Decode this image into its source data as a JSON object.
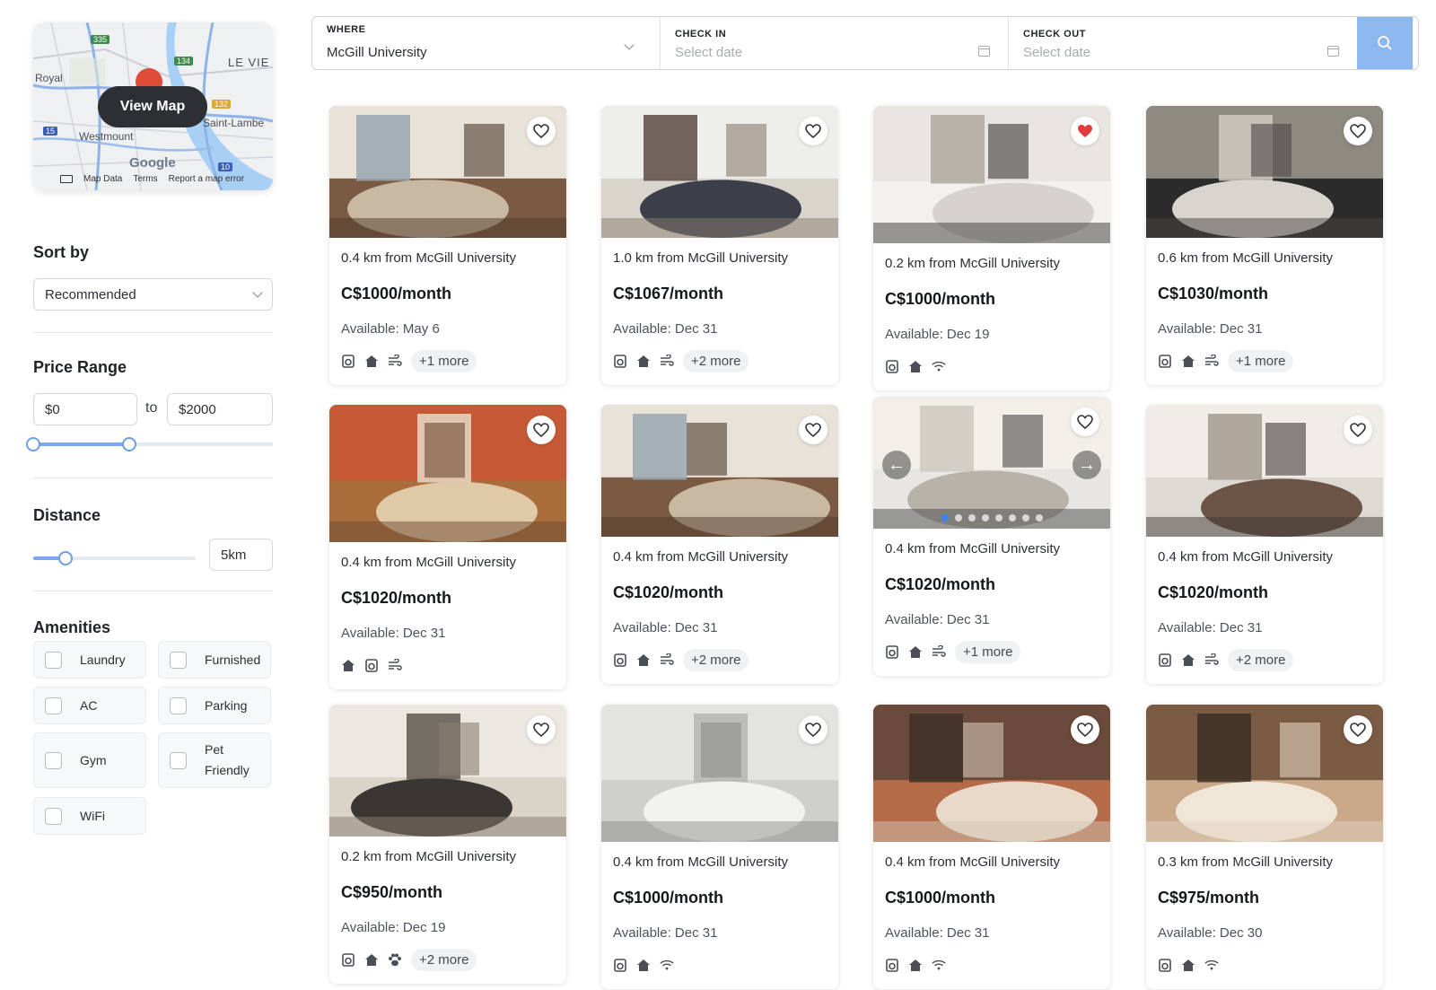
{
  "map": {
    "view_map_label": "View Map",
    "place_labels": [
      "Royal",
      "LE VIE",
      "Westmount",
      "Saint-Lambe"
    ],
    "route_badges": [
      "335",
      "134",
      "132",
      "15",
      "10"
    ],
    "google_label": "Google",
    "footer": {
      "map_data": "Map Data",
      "terms": "Terms",
      "report": "Report a map error"
    }
  },
  "filters": {
    "sort_title": "Sort by",
    "sort_value": "Recommended",
    "price_title": "Price Range",
    "price_min": "$0",
    "price_to": "to",
    "price_max": "$2000",
    "price_range_fraction": [
      0.0,
      0.4
    ],
    "distance_title": "Distance",
    "distance_value": "5km",
    "distance_fraction": 0.2,
    "amenities_title": "Amenities",
    "amenities": [
      "Laundry",
      "Furnished",
      "AC",
      "Parking",
      "Gym",
      "Pet Friendly",
      "WiFi"
    ]
  },
  "search": {
    "where_label": "WHERE",
    "where_value": "McGill University",
    "checkin_label": "CHECK IN",
    "checkin_placeholder": "Select date",
    "checkout_label": "CHECK OUT",
    "checkout_placeholder": "Select date"
  },
  "listings": [
    {
      "distance": "0.4 km from McGill University",
      "price": "C$1000/month",
      "available": "Available: May 6",
      "icons": [
        "laundry-icon",
        "home-icon",
        "ac-icon"
      ],
      "more": "+1 more",
      "favorited": false
    },
    {
      "distance": "1.0 km from McGill University",
      "price": "C$1067/month",
      "available": "Available: Dec 31",
      "icons": [
        "laundry-icon",
        "home-icon",
        "ac-icon"
      ],
      "more": "+2 more",
      "favorited": false
    },
    {
      "distance": "0.2 km from McGill University",
      "price": "C$1000/month",
      "available": "Available: Dec 19",
      "icons": [
        "laundry-icon",
        "home-icon",
        "wifi-icon"
      ],
      "more": "",
      "favorited": true
    },
    {
      "distance": "0.6 km from McGill University",
      "price": "C$1030/month",
      "available": "Available: Dec 31",
      "icons": [
        "laundry-icon",
        "home-icon",
        "ac-icon"
      ],
      "more": "+1 more",
      "favorited": false
    },
    {
      "distance": "0.4 km from McGill University",
      "price": "C$1020/month",
      "available": "Available: Dec 31",
      "icons": [
        "home-icon",
        "laundry-icon",
        "ac-icon"
      ],
      "more": "",
      "favorited": false
    },
    {
      "distance": "0.4 km from McGill University",
      "price": "C$1020/month",
      "available": "Available: Dec 31",
      "icons": [
        "laundry-icon",
        "home-icon",
        "ac-icon"
      ],
      "more": "+2 more",
      "favorited": false
    },
    {
      "distance": "0.4 km from McGill University",
      "price": "C$1020/month",
      "available": "Available: Dec 31",
      "icons": [
        "laundry-icon",
        "home-icon",
        "ac-icon"
      ],
      "more": "+1 more",
      "favorited": false,
      "carousel": {
        "count": 8,
        "active": 0,
        "prev_icon": "arrow-left-icon",
        "next_icon": "arrow-right-icon"
      }
    },
    {
      "distance": "0.4 km from McGill University",
      "price": "C$1020/month",
      "available": "Available: Dec 31",
      "icons": [
        "laundry-icon",
        "home-icon",
        "ac-icon"
      ],
      "more": "+2 more",
      "favorited": false
    },
    {
      "distance": "0.2 km from McGill University",
      "price": "C$950/month",
      "available": "Available: Dec 19",
      "icons": [
        "laundry-icon",
        "home-icon",
        "paw-icon"
      ],
      "more": "+2 more",
      "favorited": false
    },
    {
      "distance": "0.4 km from McGill University",
      "price": "C$1000/month",
      "available": "Available: Dec 31",
      "icons": [
        "laundry-icon",
        "home-icon",
        "wifi-icon"
      ],
      "more": "",
      "favorited": false
    },
    {
      "distance": "0.4 km from McGill University",
      "price": "C$1000/month",
      "available": "Available: Dec 31",
      "icons": [
        "laundry-icon",
        "home-icon",
        "wifi-icon"
      ],
      "more": "",
      "favorited": false
    },
    {
      "distance": "0.3 km from McGill University",
      "price": "C$975/month",
      "available": "Available: Dec 30",
      "icons": [
        "laundry-icon",
        "home-icon",
        "wifi-icon"
      ],
      "more": "",
      "favorited": false
    }
  ],
  "colors": {
    "accent": "#8db7ef",
    "slider": "#6d9fe6",
    "favorite_red": "#e23b3b",
    "map_button": "#2e2f33"
  }
}
